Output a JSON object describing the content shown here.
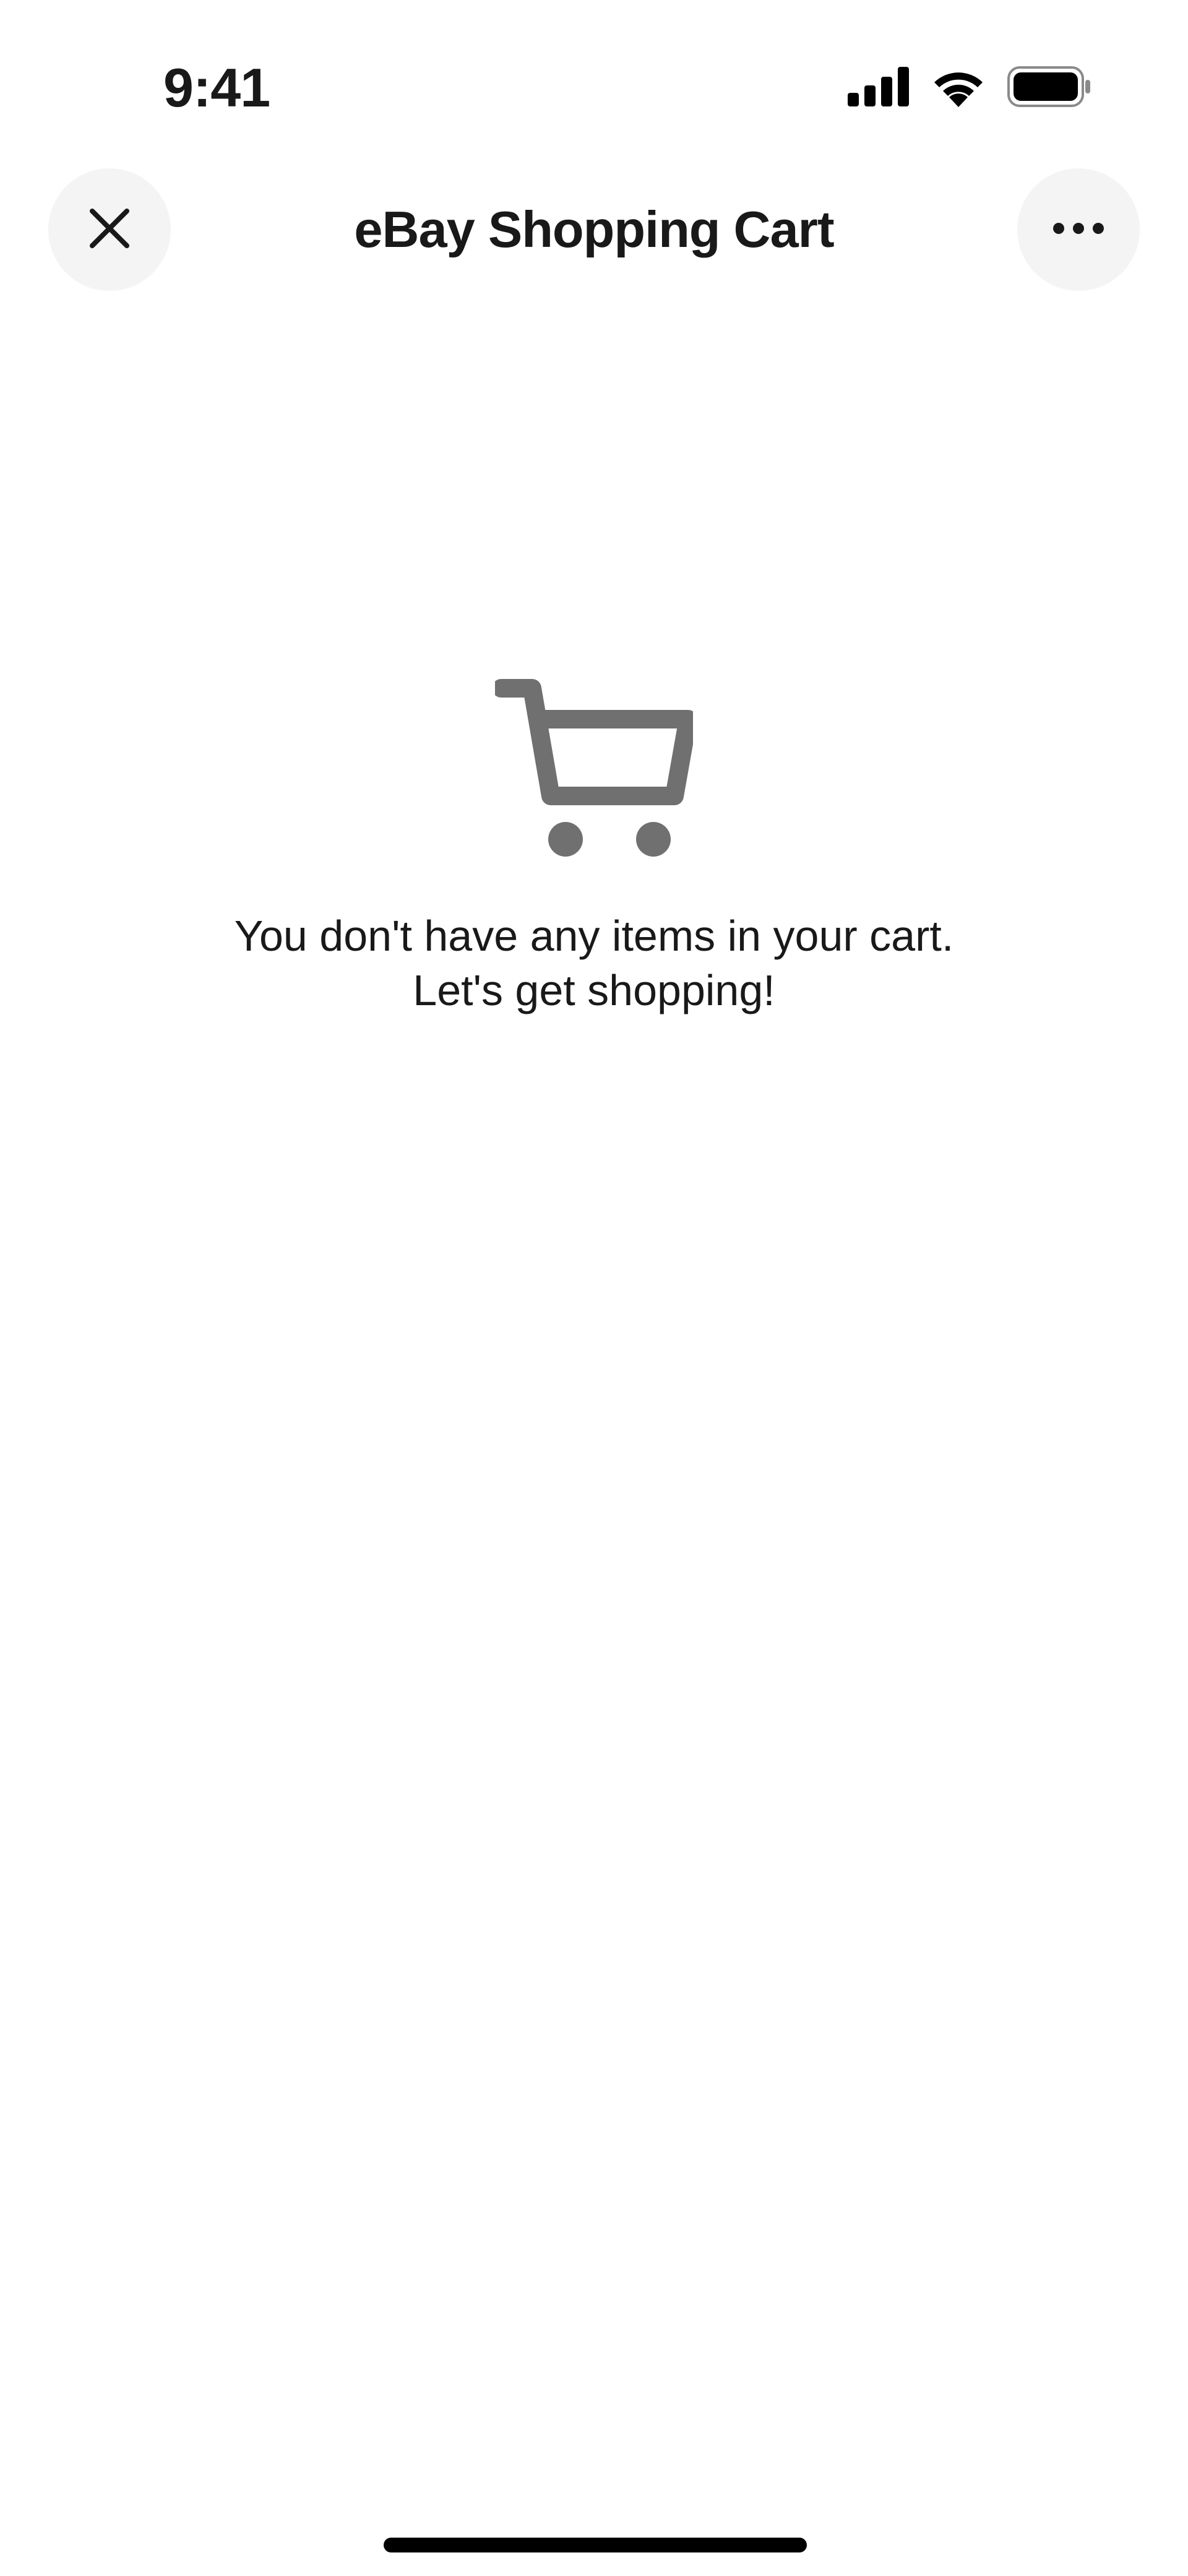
{
  "status_bar": {
    "time": "9:41",
    "icons": [
      "cellular-signal-icon",
      "wifi-icon",
      "battery-icon"
    ]
  },
  "header": {
    "title": "eBay Shopping Cart",
    "close_icon": "close-icon",
    "more_icon": "more-horizontal-icon"
  },
  "empty_state": {
    "icon": "shopping-cart-icon",
    "message": "You don't have any items in your cart. Let's get shopping!"
  },
  "colors": {
    "text": "#191919",
    "button_bg": "#f4f4f4",
    "cart_icon": "#707070",
    "background": "#ffffff"
  }
}
